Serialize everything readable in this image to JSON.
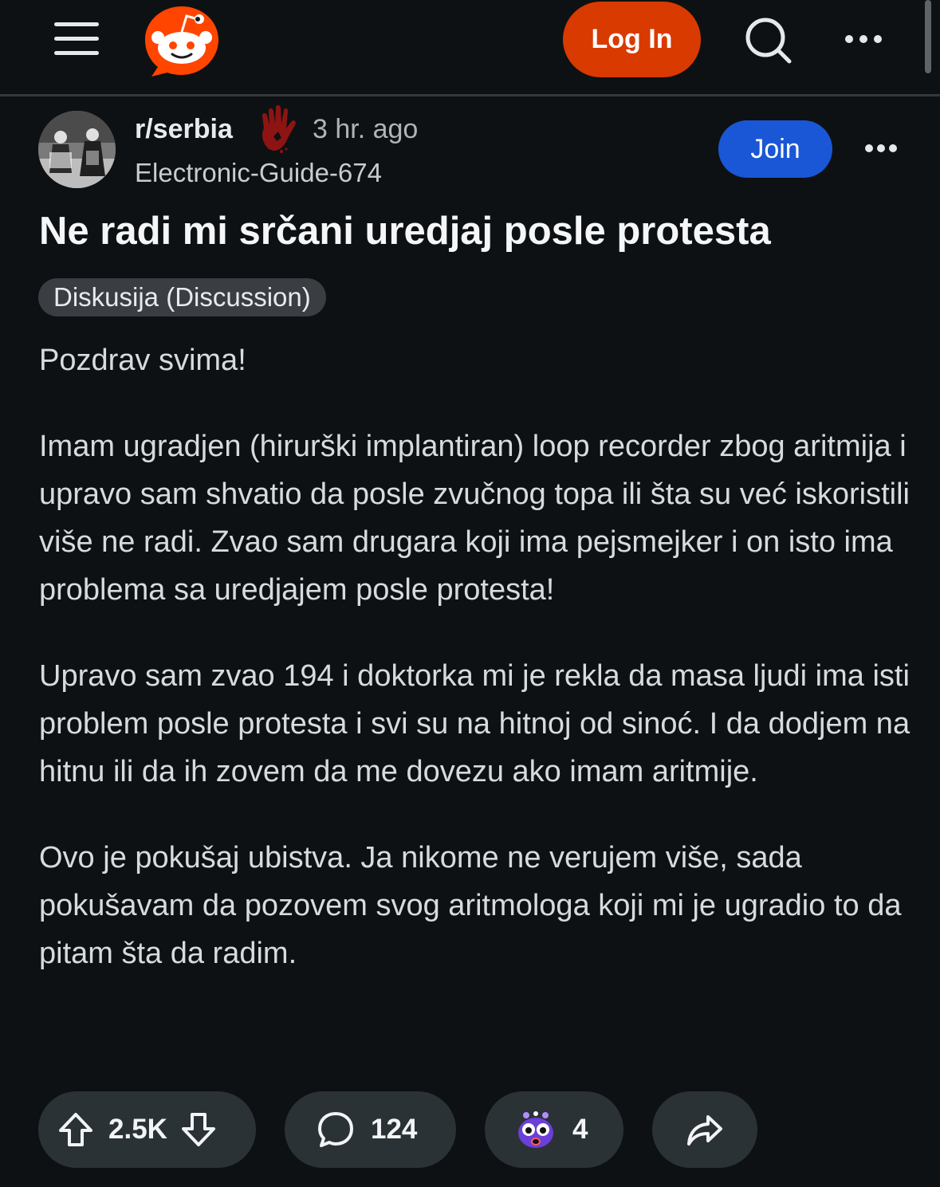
{
  "header": {
    "login_label": "Log In"
  },
  "post": {
    "subreddit": "r/serbia",
    "time_ago": "3 hr. ago",
    "author": "Electronic-Guide-674",
    "join_label": "Join",
    "title": "Ne radi mi srčani uredjaj posle protesta",
    "flair": "Diskusija (Discussion)",
    "paragraphs": [
      "Pozdrav svima!",
      "Imam ugradjen (hirurški implantiran) loop recorder zbog aritmija i upravo sam shvatio da posle zvučnog topa ili šta su već iskoristili više ne radi. Zvao sam drugara koji ima pejsmejker i on isto ima problema sa uredjajem posle protesta!",
      "Upravo sam zvao 194 i doktorka mi je rekla da masa ljudi ima isti problem posle protesta i svi su na hitnoj od sinoć. I da dodjem na hitnu ili da ih zovem da me dovezu ako imam aritmije.",
      "Ovo je pokušaj ubistva. Ja nikome ne verujem više, sada pokušavam da pozovem svog aritmologa koji mi je ugradio to da pitam šta da radim."
    ]
  },
  "actions": {
    "vote_count": "2.5K",
    "comment_count": "124",
    "award_count": "4"
  },
  "colors": {
    "background": "#0e1113",
    "login_button": "#d93a00",
    "join_button": "#1a57d6",
    "pill": "#2a3236",
    "reddit_orange": "#ff4500"
  },
  "icons": {
    "menu": "hamburger-icon",
    "logo": "reddit-logo",
    "search": "search-icon",
    "more": "more-horizontal-icon",
    "upvote": "upvote-arrow-icon",
    "downvote": "downvote-arrow-icon",
    "comment": "comment-bubble-icon",
    "award": "shocked-face-award-icon",
    "share": "share-arrow-icon",
    "flair_hand": "bloody-hand-icon"
  }
}
